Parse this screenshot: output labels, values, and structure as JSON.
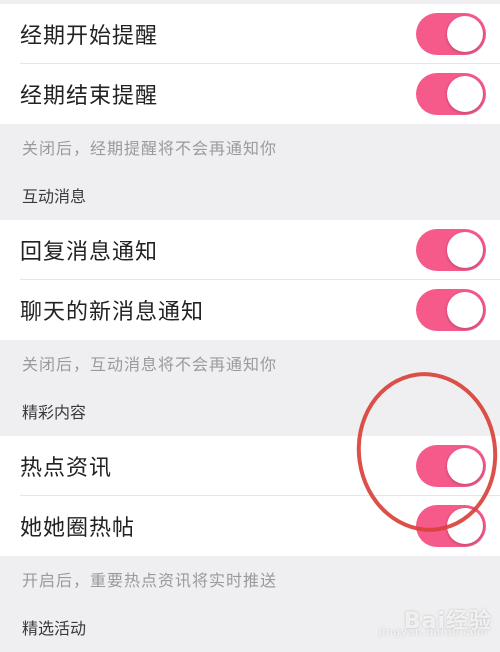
{
  "groups": [
    {
      "header": "",
      "items": [
        {
          "label": "经期开始提醒",
          "enabled": true
        },
        {
          "label": "经期结束提醒",
          "enabled": true
        }
      ],
      "note": "关闭后，经期提醒将不会再通知你"
    },
    {
      "header": "互动消息",
      "items": [
        {
          "label": "回复消息通知",
          "enabled": true
        },
        {
          "label": "聊天的新消息通知",
          "enabled": true
        }
      ],
      "note": "关闭后，互动消息将不会再通知你"
    },
    {
      "header": "精彩内容",
      "items": [
        {
          "label": "热点资讯",
          "enabled": true
        },
        {
          "label": "她她圈热帖",
          "enabled": true
        }
      ],
      "note": "开启后，重要热点资讯将实时推送"
    },
    {
      "header": "精选活动"
    }
  ],
  "watermark": {
    "text": "Bai经验",
    "sub": "jingyan.baidu.com"
  },
  "colors": {
    "toggle_on": "#f65a8b",
    "annotation": "#d9413b",
    "background": "#efeff1"
  }
}
